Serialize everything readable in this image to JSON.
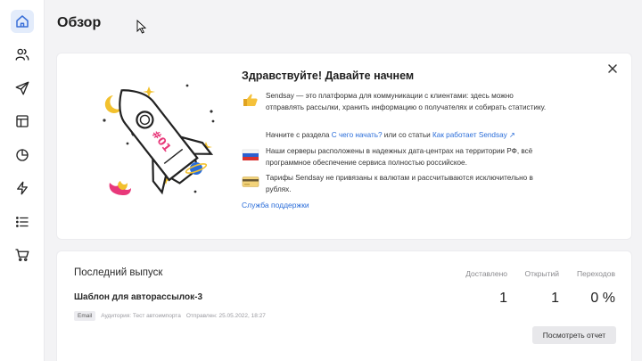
{
  "sidebar": {
    "items": [
      {
        "icon": "home-icon",
        "active": true
      },
      {
        "icon": "users-icon"
      },
      {
        "icon": "send-icon"
      },
      {
        "icon": "layout-icon"
      },
      {
        "icon": "pie-chart-icon"
      },
      {
        "icon": "lightning-icon"
      },
      {
        "icon": "list-icon"
      },
      {
        "icon": "cart-icon"
      }
    ],
    "active_color": "#3a6fd8"
  },
  "header": {
    "title": "Обзор"
  },
  "welcome": {
    "title": "Здравствуйте! Давайте начнем",
    "intro": "Sendsay — это платформа для коммуникации с клиентами: здесь можно отправлять рассылки, хранить информацию о получателях и собирать статистику.",
    "start_prefix": "Начните с раздела ",
    "start_link": "С чего начать?",
    "start_middle": " или со статьи ",
    "start_article": "Как работает Sendsay",
    "servers": "Наши серверы расположены в надежных дата-центрах на территории РФ, всё программное обеспечение сервиса полностью российское.",
    "tariffs": "Тарифы Sendsay не привязаны к валютам и рассчитываются исключительно в рублях.",
    "support_link": "Служба поддержки",
    "rocket_label": "#01"
  },
  "last_issue": {
    "title": "Последний выпуск",
    "template_name": "Шаблон для авторассылок-3",
    "badge": "Email",
    "audience": "Аудитория: Тест автоимпорта",
    "sent": "Отправлен: 25.05.2022, 18:27",
    "stats": [
      {
        "label": "Доставлено",
        "value": "1"
      },
      {
        "label": "Открытий",
        "value": "1"
      },
      {
        "label": "Переходов",
        "value": "0 %"
      }
    ],
    "report_button": "Посмотреть отчет"
  },
  "colors": {
    "accent": "#2a6dd9",
    "rocket_pink": "#e8387a",
    "star_yellow": "#f2c12e"
  }
}
